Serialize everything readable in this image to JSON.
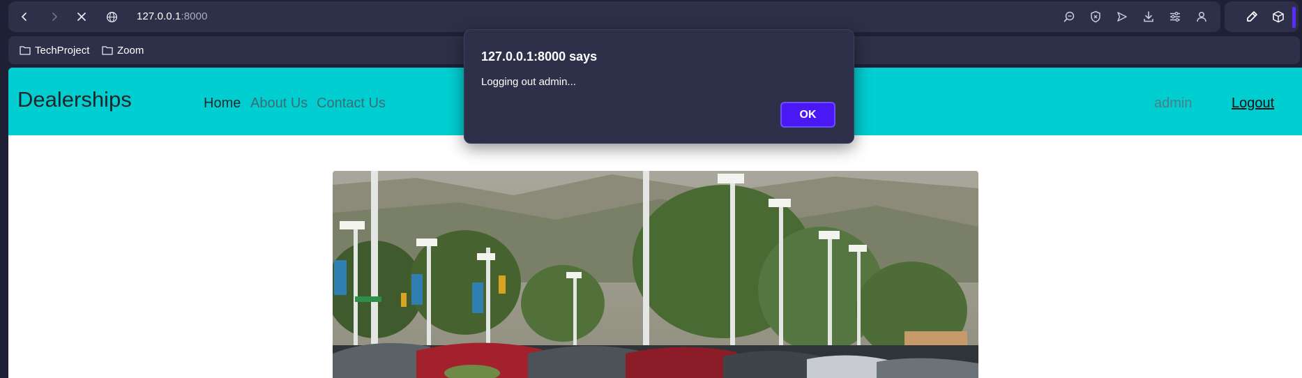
{
  "browser": {
    "url_host": "127.0.0.1",
    "url_port": ":8000",
    "bookmarks": [
      {
        "label": "TechProject"
      },
      {
        "label": "Zoom"
      }
    ],
    "accent_color": "#5b2bff"
  },
  "site": {
    "brand": "Dealerships",
    "nav": {
      "home": "Home",
      "about": "About Us",
      "contact": "Contact Us"
    },
    "user": "admin",
    "logout": "Logout",
    "nav_color": "#00ced1"
  },
  "dialog": {
    "title": "127.0.0.1:8000 says",
    "message": "Logging out admin...",
    "ok": "OK",
    "ok_color": "#4a18f5"
  }
}
